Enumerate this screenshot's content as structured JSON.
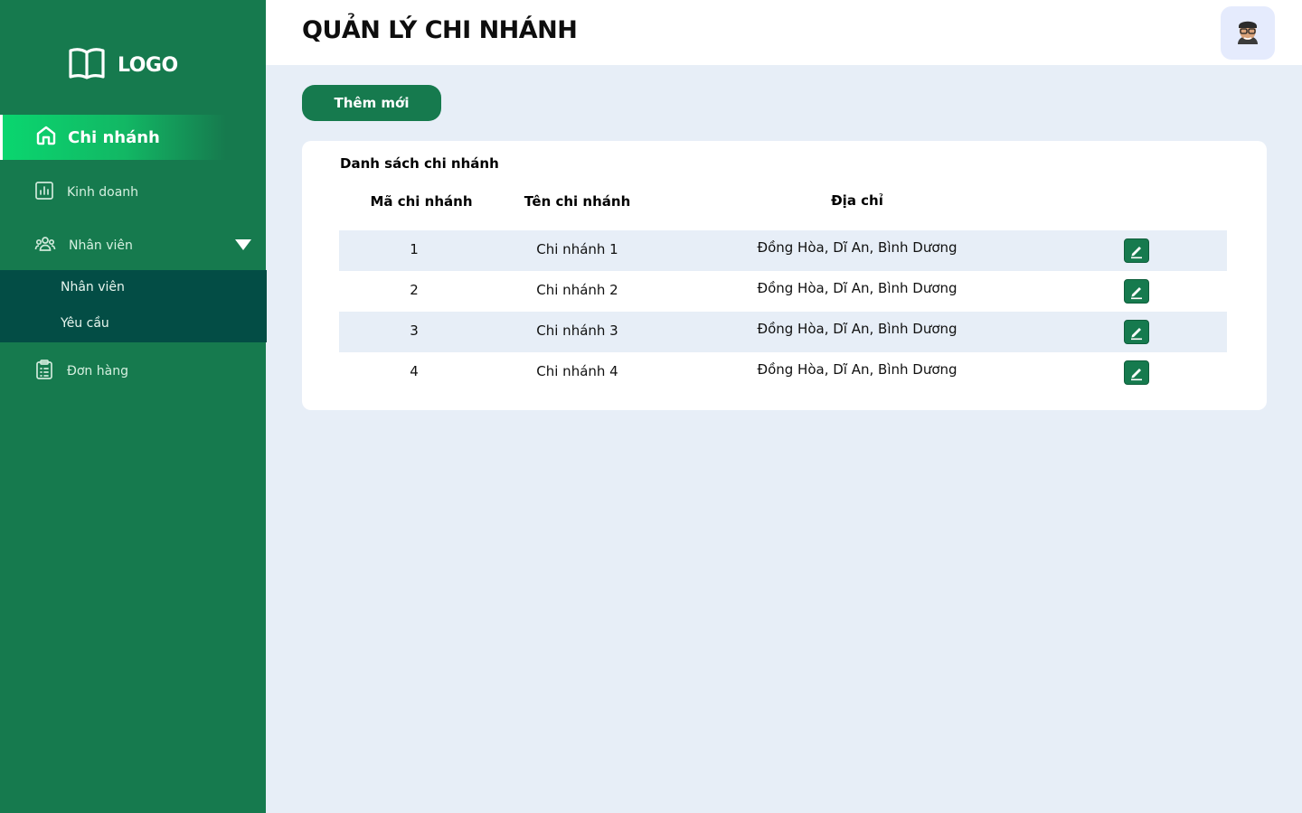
{
  "brand": {
    "logo_text": "LOGO"
  },
  "sidebar": {
    "active": {
      "label": "Chi nhánh",
      "icon": "home-icon"
    },
    "items": [
      {
        "label": "Kinh doanh",
        "icon": "chart-icon"
      },
      {
        "label": "Nhân viên",
        "icon": "users-icon",
        "expanded": true
      },
      {
        "label": "Đơn hàng",
        "icon": "clipboard-icon"
      }
    ],
    "submenu": [
      {
        "label": "Nhân viên"
      },
      {
        "label": "Yêu cầu"
      }
    ]
  },
  "header": {
    "title": "QUẢN LÝ CHI NHÁNH",
    "avatar_icon": "user-avatar-icon"
  },
  "actions": {
    "add_label": "Thêm mới"
  },
  "table": {
    "title": "Danh sách chi nhánh",
    "columns": [
      "Mã chi nhánh",
      "Tên chi nhánh",
      "Địa chỉ"
    ],
    "rows": [
      {
        "id": "1",
        "name": "Chi nhánh 1",
        "address": "Đồng Hòa,  Dĩ  An, Bình Dương",
        "action_icon": "edit-icon"
      },
      {
        "id": "2",
        "name": "Chi nhánh 2",
        "address": "Đồng Hòa,  Dĩ  An, Bình Dương",
        "action_icon": "edit-icon"
      },
      {
        "id": "3",
        "name": "Chi nhánh 3",
        "address": "Đồng Hòa,  Dĩ  An, Bình Dương",
        "action_icon": "edit-icon"
      },
      {
        "id": "4",
        "name": "Chi nhánh 4",
        "address": "Đồng Hòa,  Dĩ  An, Bình Dương",
        "action_icon": "edit-icon"
      }
    ]
  },
  "colors": {
    "sidebar_bg": "#167a4e",
    "active_gradient": "#0ad66f",
    "submenu_bg": "#034d45",
    "page_bg": "#e7eef7",
    "row_alt": "#e7eef7"
  }
}
